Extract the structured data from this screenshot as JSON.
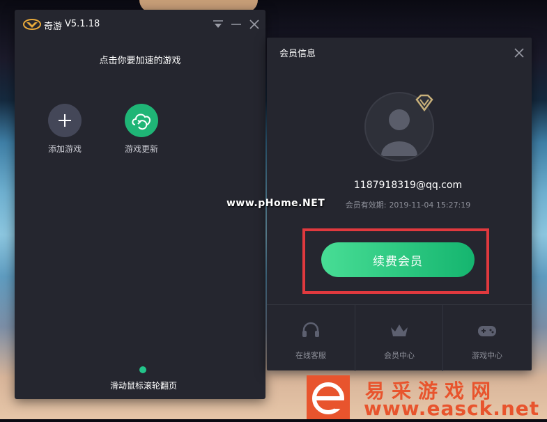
{
  "main_window": {
    "app_name": "奇游",
    "version": "V5.1.18",
    "prompt": "点击你要加速的游戏",
    "tiles": [
      {
        "label": "添加游戏",
        "icon": "plus-icon"
      },
      {
        "label": "游戏更新",
        "icon": "cloud-refresh-icon"
      }
    ],
    "scroll_hint": "滑动鼠标滚轮翻页"
  },
  "member_window": {
    "title": "会员信息",
    "email": "1187918319@qq.com",
    "expiry_label": "会员有效期:",
    "expiry_value": "2019-11-04 15:27:19",
    "renew_label": "续费会员",
    "bottom_items": [
      {
        "label": "在线客服",
        "icon": "headset-icon"
      },
      {
        "label": "会员中心",
        "icon": "crown-icon"
      },
      {
        "label": "游戏中心",
        "icon": "gamepad-icon"
      }
    ]
  },
  "watermarks": {
    "phome": "www.pHome.NET",
    "site_cn": "易采游戏网",
    "site_url": "www.easck.net"
  },
  "colors": {
    "accent_green": "#15b56f",
    "highlight_red": "#e0393e",
    "window_bg": "#25262f",
    "watermark_orange": "#e8542d"
  }
}
